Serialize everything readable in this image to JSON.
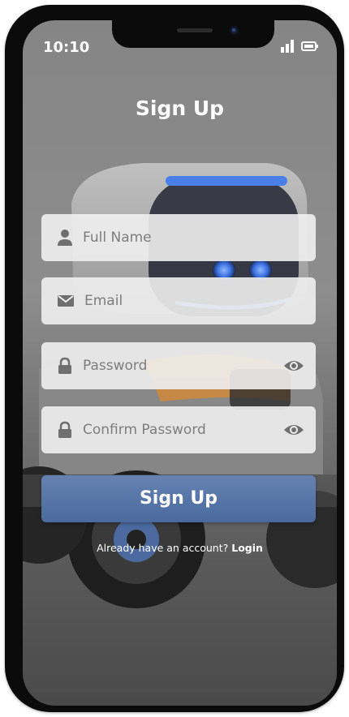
{
  "status_bar": {
    "time": "10:10"
  },
  "screen": {
    "title": "Sign Up"
  },
  "form": {
    "full_name": {
      "placeholder": "Full Name",
      "icon": "person-icon"
    },
    "email": {
      "placeholder": "Email",
      "icon": "mail-icon"
    },
    "password": {
      "placeholder": "Password",
      "icon": "lock-icon",
      "toggle_icon": "eye-icon"
    },
    "confirm_password": {
      "placeholder": "Confirm Password",
      "icon": "lock-icon",
      "toggle_icon": "eye-icon"
    },
    "submit_label": "Sign Up"
  },
  "footer": {
    "prompt": "Already have an account? ",
    "login_label": "Login"
  },
  "colors": {
    "accent": "#5574a7",
    "field_bg": "#f0f0f0",
    "placeholder": "#7d7d7d"
  }
}
